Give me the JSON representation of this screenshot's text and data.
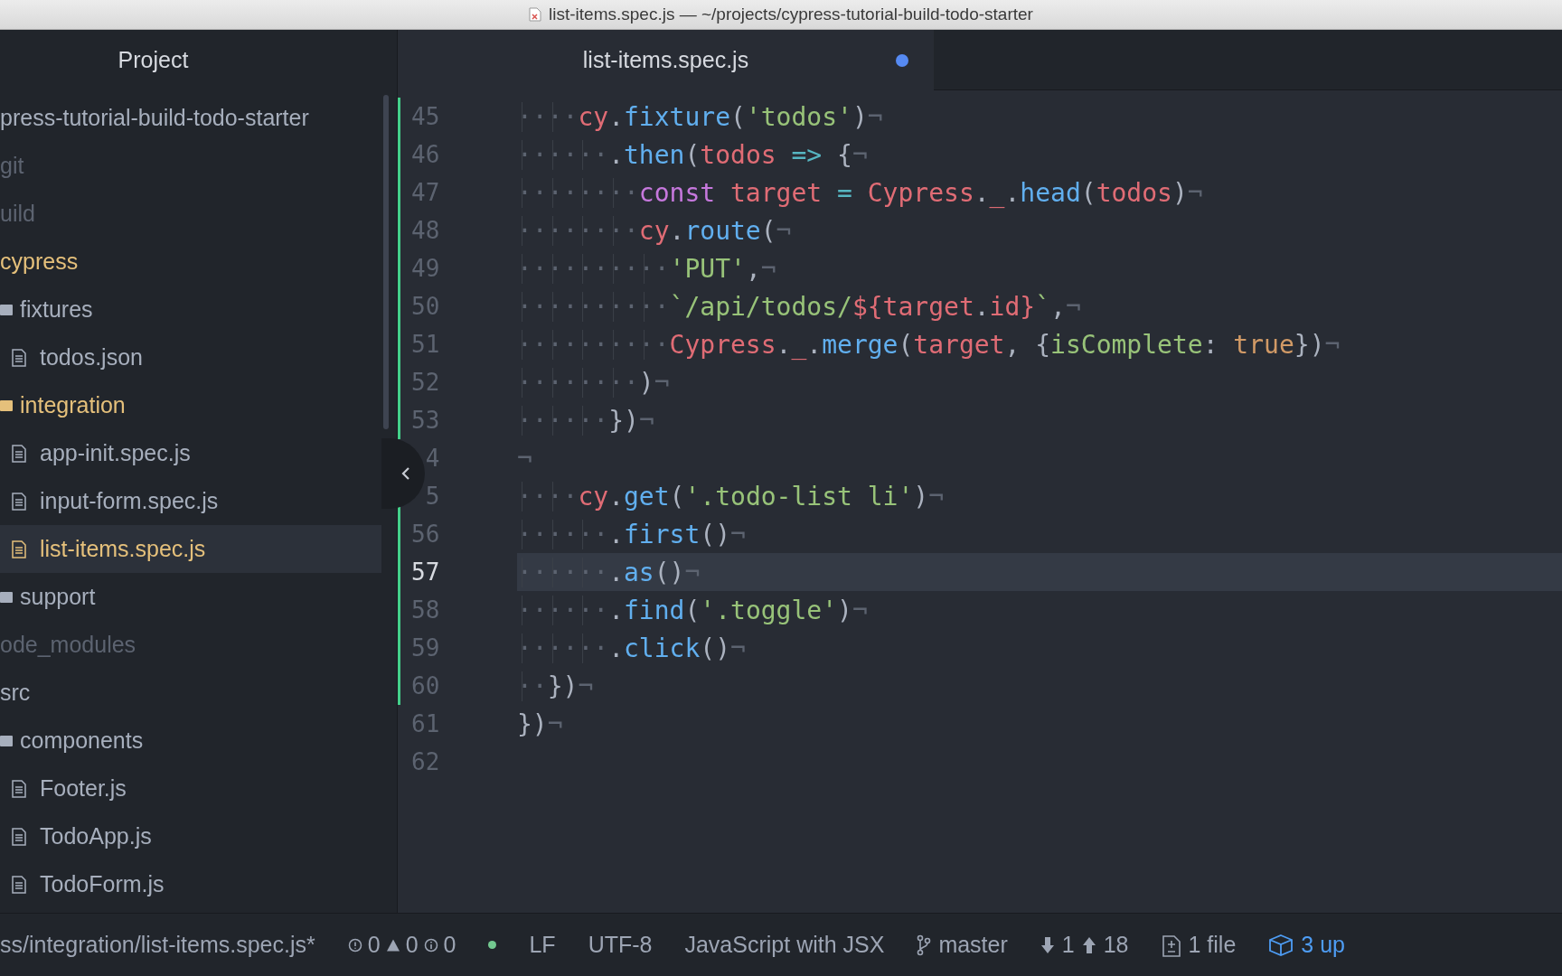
{
  "window": {
    "title": "list-items.spec.js — ~/projects/cypress-tutorial-build-todo-starter"
  },
  "sidebar": {
    "title": "Project",
    "tree": [
      {
        "name": "press-tutorial-build-todo-starter",
        "modified": false,
        "ignored": false,
        "selected": false,
        "children": [
          {
            "name": "git",
            "modified": false,
            "ignored": true,
            "selected": false
          },
          {
            "name": "uild",
            "modified": false,
            "ignored": true,
            "selected": false
          },
          {
            "name": "cypress",
            "modified": true,
            "ignored": false,
            "selected": false,
            "children": [
              {
                "name": "fixtures",
                "kind": "folder",
                "modified": false,
                "ignored": false,
                "selected": false,
                "children": [
                  {
                    "name": "todos.json",
                    "kind": "file",
                    "modified": false,
                    "ignored": false,
                    "selected": false
                  }
                ]
              },
              {
                "name": "integration",
                "kind": "folder",
                "modified": true,
                "ignored": false,
                "selected": false,
                "children": [
                  {
                    "name": "app-init.spec.js",
                    "kind": "file",
                    "modified": false,
                    "ignored": false,
                    "selected": false
                  },
                  {
                    "name": "input-form.spec.js",
                    "kind": "file",
                    "modified": false,
                    "ignored": false,
                    "selected": false
                  },
                  {
                    "name": "list-items.spec.js",
                    "kind": "file",
                    "modified": true,
                    "ignored": false,
                    "selected": true
                  }
                ]
              },
              {
                "name": "support",
                "kind": "folder",
                "modified": false,
                "ignored": false,
                "selected": false
              }
            ]
          },
          {
            "name": "ode_modules",
            "modified": false,
            "ignored": true,
            "selected": false
          },
          {
            "name": "src",
            "modified": false,
            "ignored": false,
            "selected": false,
            "children": [
              {
                "name": "components",
                "kind": "folder",
                "modified": false,
                "ignored": false,
                "selected": false,
                "children": [
                  {
                    "name": "Footer.js",
                    "kind": "file",
                    "modified": false,
                    "ignored": false,
                    "selected": false
                  },
                  {
                    "name": "TodoApp.js",
                    "kind": "file",
                    "modified": false,
                    "ignored": false,
                    "selected": false
                  },
                  {
                    "name": "TodoForm.js",
                    "kind": "file",
                    "modified": false,
                    "ignored": false,
                    "selected": false
                  }
                ]
              }
            ]
          }
        ]
      }
    ]
  },
  "tabs": [
    {
      "label": "list-items.spec.js",
      "selected": true,
      "modified": true
    }
  ],
  "editor": {
    "lines": [
      {
        "number": "45",
        "added": true,
        "current": false,
        "tokens": [
          {
            "kind": "ws",
            "t": "····"
          },
          {
            "kind": "var",
            "t": "cy"
          },
          {
            "kind": "punc",
            "t": "."
          },
          {
            "kind": "func",
            "t": "fixture"
          },
          {
            "kind": "punc",
            "t": "("
          },
          {
            "kind": "str",
            "t": "'todos'"
          },
          {
            "kind": "punc",
            "t": ")"
          },
          {
            "kind": "eol",
            "t": "¬"
          }
        ]
      },
      {
        "number": "46",
        "added": true,
        "current": false,
        "tokens": [
          {
            "kind": "ws",
            "t": "······"
          },
          {
            "kind": "punc",
            "t": "."
          },
          {
            "kind": "func",
            "t": "then"
          },
          {
            "kind": "punc",
            "t": "("
          },
          {
            "kind": "var",
            "t": "todos"
          },
          {
            "kind": "op",
            "t": " =>"
          },
          {
            "kind": "punc",
            "t": " {"
          },
          {
            "kind": "eol",
            "t": "¬"
          }
        ]
      },
      {
        "number": "47",
        "added": true,
        "current": false,
        "tokens": [
          {
            "kind": "ws",
            "t": "········"
          },
          {
            "kind": "kw",
            "t": "const"
          },
          {
            "kind": "var",
            "t": " target"
          },
          {
            "kind": "op",
            "t": " ="
          },
          {
            "kind": "var",
            "t": " Cypress"
          },
          {
            "kind": "punc",
            "t": "."
          },
          {
            "kind": "var",
            "t": "_"
          },
          {
            "kind": "punc",
            "t": "."
          },
          {
            "kind": "func",
            "t": "head"
          },
          {
            "kind": "punc",
            "t": "("
          },
          {
            "kind": "var",
            "t": "todos"
          },
          {
            "kind": "punc",
            "t": ")"
          },
          {
            "kind": "eol",
            "t": "¬"
          }
        ]
      },
      {
        "number": "48",
        "added": true,
        "current": false,
        "tokens": [
          {
            "kind": "ws",
            "t": "········"
          },
          {
            "kind": "var",
            "t": "cy"
          },
          {
            "kind": "punc",
            "t": "."
          },
          {
            "kind": "func",
            "t": "route"
          },
          {
            "kind": "punc",
            "t": "("
          },
          {
            "kind": "eol",
            "t": "¬"
          }
        ]
      },
      {
        "number": "49",
        "added": true,
        "current": false,
        "tokens": [
          {
            "kind": "ws",
            "t": "··········"
          },
          {
            "kind": "str",
            "t": "'PUT'"
          },
          {
            "kind": "punc",
            "t": ","
          },
          {
            "kind": "eol",
            "t": "¬"
          }
        ]
      },
      {
        "number": "50",
        "added": true,
        "current": false,
        "tokens": [
          {
            "kind": "ws",
            "t": "··········"
          },
          {
            "kind": "str",
            "t": "`/api/todos/"
          },
          {
            "kind": "var",
            "t": "${target"
          },
          {
            "kind": "punc",
            "t": "."
          },
          {
            "kind": "var",
            "t": "id}"
          },
          {
            "kind": "str",
            "t": "`"
          },
          {
            "kind": "punc",
            "t": ","
          },
          {
            "kind": "eol",
            "t": "¬"
          }
        ]
      },
      {
        "number": "51",
        "added": true,
        "current": false,
        "tokens": [
          {
            "kind": "ws",
            "t": "··········"
          },
          {
            "kind": "var",
            "t": "Cypress"
          },
          {
            "kind": "punc",
            "t": "."
          },
          {
            "kind": "var",
            "t": "_"
          },
          {
            "kind": "punc",
            "t": "."
          },
          {
            "kind": "func",
            "t": "merge"
          },
          {
            "kind": "punc",
            "t": "("
          },
          {
            "kind": "var",
            "t": "target"
          },
          {
            "kind": "punc",
            "t": ", {"
          },
          {
            "kind": "str",
            "t": "isComplete"
          },
          {
            "kind": "punc",
            "t": ": "
          },
          {
            "kind": "const",
            "t": "true"
          },
          {
            "kind": "punc",
            "t": "})"
          },
          {
            "kind": "eol",
            "t": "¬"
          }
        ]
      },
      {
        "number": "52",
        "added": true,
        "current": false,
        "tokens": [
          {
            "kind": "ws",
            "t": "········"
          },
          {
            "kind": "punc",
            "t": ")"
          },
          {
            "kind": "eol",
            "t": "¬"
          }
        ]
      },
      {
        "number": "53",
        "added": true,
        "current": false,
        "tokens": [
          {
            "kind": "ws",
            "t": "······"
          },
          {
            "kind": "punc",
            "t": "})"
          },
          {
            "kind": "eol",
            "t": "¬"
          }
        ]
      },
      {
        "number": "4",
        "added": false,
        "current": false,
        "tokens": [
          {
            "kind": "eol",
            "t": "¬"
          }
        ]
      },
      {
        "number": "5",
        "added": true,
        "current": false,
        "tokens": [
          {
            "kind": "ws",
            "t": "····"
          },
          {
            "kind": "var",
            "t": "cy"
          },
          {
            "kind": "punc",
            "t": "."
          },
          {
            "kind": "func",
            "t": "get"
          },
          {
            "kind": "punc",
            "t": "("
          },
          {
            "kind": "str",
            "t": "'.todo-list li'"
          },
          {
            "kind": "punc",
            "t": ")"
          },
          {
            "kind": "eol",
            "t": "¬"
          }
        ]
      },
      {
        "number": "56",
        "added": true,
        "current": false,
        "tokens": [
          {
            "kind": "ws",
            "t": "······"
          },
          {
            "kind": "punc",
            "t": "."
          },
          {
            "kind": "func",
            "t": "first"
          },
          {
            "kind": "punc",
            "t": "()"
          },
          {
            "kind": "eol",
            "t": "¬"
          }
        ]
      },
      {
        "number": "57",
        "added": true,
        "current": true,
        "tokens": [
          {
            "kind": "ws",
            "t": "······"
          },
          {
            "kind": "punc",
            "t": "."
          },
          {
            "kind": "func",
            "t": "as"
          },
          {
            "kind": "punc",
            "t": "()"
          },
          {
            "kind": "eol",
            "t": "¬"
          }
        ]
      },
      {
        "number": "58",
        "added": true,
        "current": false,
        "tokens": [
          {
            "kind": "ws",
            "t": "······"
          },
          {
            "kind": "punc",
            "t": "."
          },
          {
            "kind": "func",
            "t": "find"
          },
          {
            "kind": "punc",
            "t": "("
          },
          {
            "kind": "str",
            "t": "'.toggle'"
          },
          {
            "kind": "punc",
            "t": ")"
          },
          {
            "kind": "eol",
            "t": "¬"
          }
        ]
      },
      {
        "number": "59",
        "added": true,
        "current": false,
        "tokens": [
          {
            "kind": "ws",
            "t": "······"
          },
          {
            "kind": "punc",
            "t": "."
          },
          {
            "kind": "func",
            "t": "click"
          },
          {
            "kind": "punc",
            "t": "()"
          },
          {
            "kind": "eol",
            "t": "¬"
          }
        ]
      },
      {
        "number": "60",
        "added": true,
        "current": false,
        "tokens": [
          {
            "kind": "ws",
            "t": "··"
          },
          {
            "kind": "punc",
            "t": "})"
          },
          {
            "kind": "eol",
            "t": "¬"
          }
        ]
      },
      {
        "number": "61",
        "added": false,
        "current": false,
        "tokens": [
          {
            "kind": "punc",
            "t": "})"
          },
          {
            "kind": "eol",
            "t": "¬"
          }
        ]
      },
      {
        "number": "62",
        "added": false,
        "current": false
      }
    ]
  },
  "status_bar": {
    "path": "ss/integration/list-items.spec.js*",
    "errors": "0",
    "warnings": "0",
    "infos": "0",
    "line_ending": "LF",
    "encoding": "UTF-8",
    "grammar": "JavaScript with JSX",
    "branch": "master",
    "behind": "1",
    "ahead": "18",
    "changes": "1 file",
    "updates": "3 up"
  }
}
